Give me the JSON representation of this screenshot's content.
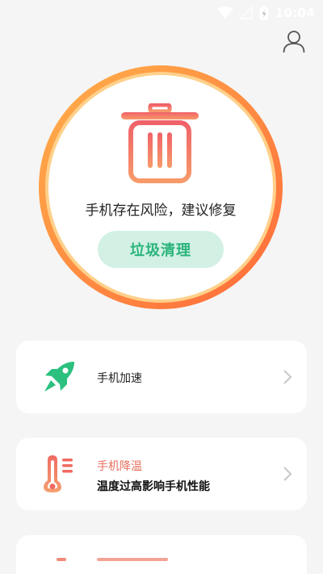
{
  "status_bar": {
    "time": "10:04",
    "icons": [
      "wifi-icon",
      "signal-icon",
      "battery-icon"
    ]
  },
  "header": {
    "profile_icon": "user-icon"
  },
  "scan_panel": {
    "status_text": "手机存在风险，建议修复",
    "clean_button_label": "垃圾清理",
    "colors": {
      "ring_outer": "#ff7a3c",
      "ring_inner": "#ffc57a",
      "trash_icon": "#f07a6a",
      "button_bg": "#d2f1e4",
      "button_text": "#2bb47c"
    }
  },
  "features": [
    {
      "title": "手机加速",
      "subtitle": "",
      "icon": "rocket-icon",
      "icon_color": "#2bc07e"
    },
    {
      "title": "手机降温",
      "subtitle": "温度过高影响手机性能",
      "icon": "thermometer-icon",
      "icon_color": "#ee7a66"
    }
  ]
}
